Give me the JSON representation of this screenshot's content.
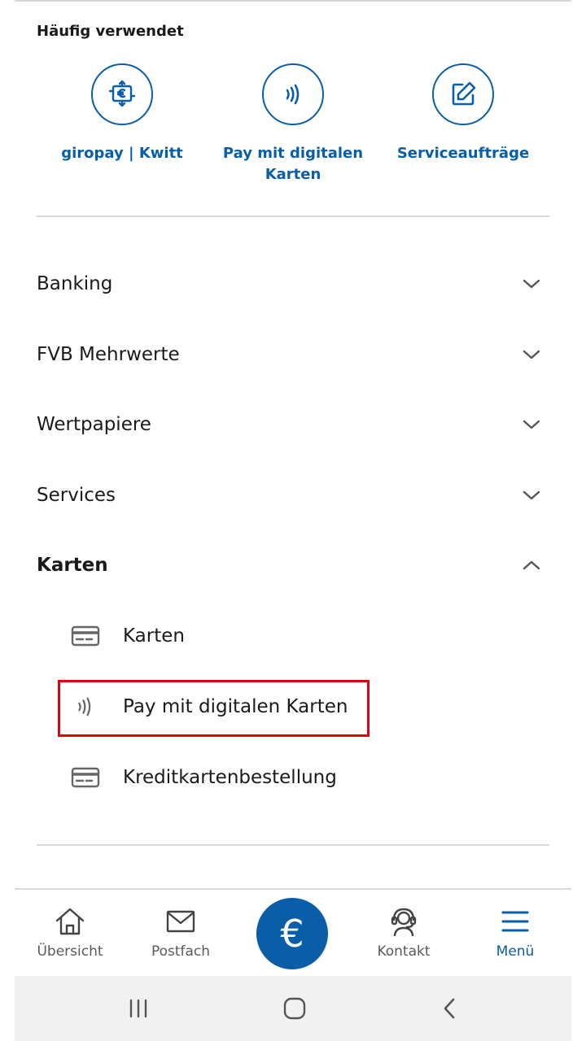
{
  "frequent": {
    "title": "Häufig verwendet",
    "items": [
      {
        "label": "giropay | Kwitt",
        "icon": "giropay-transfer-icon"
      },
      {
        "label": "Pay mit digitalen Karten",
        "icon": "contactless-icon"
      },
      {
        "label": "Serviceaufträge",
        "icon": "edit-icon"
      }
    ]
  },
  "menu": {
    "sections": [
      {
        "label": "Banking",
        "expanded": false
      },
      {
        "label": "FVB Mehrwerte",
        "expanded": false
      },
      {
        "label": "Wertpapiere",
        "expanded": false
      },
      {
        "label": "Services",
        "expanded": false
      },
      {
        "label": "Karten",
        "expanded": true
      }
    ],
    "karten_items": [
      {
        "label": "Karten",
        "icon": "card-icon"
      },
      {
        "label": "Pay mit digitalen Karten",
        "icon": "contactless-icon",
        "highlighted": true
      },
      {
        "label": "Kreditkartenbestellung",
        "icon": "card-icon"
      }
    ]
  },
  "bottom_nav": {
    "items": [
      {
        "label": "Übersicht",
        "icon": "home-icon"
      },
      {
        "label": "Postfach",
        "icon": "mail-icon"
      },
      {
        "label": "",
        "icon": "euro-icon",
        "glyph": "€"
      },
      {
        "label": "Kontakt",
        "icon": "headset-icon"
      },
      {
        "label": "Menü",
        "icon": "menu-icon",
        "active": true
      }
    ]
  },
  "colors": {
    "accent": "#0a5ea8",
    "highlight_box": "#e0000f",
    "divider": "#d9d9d9"
  }
}
